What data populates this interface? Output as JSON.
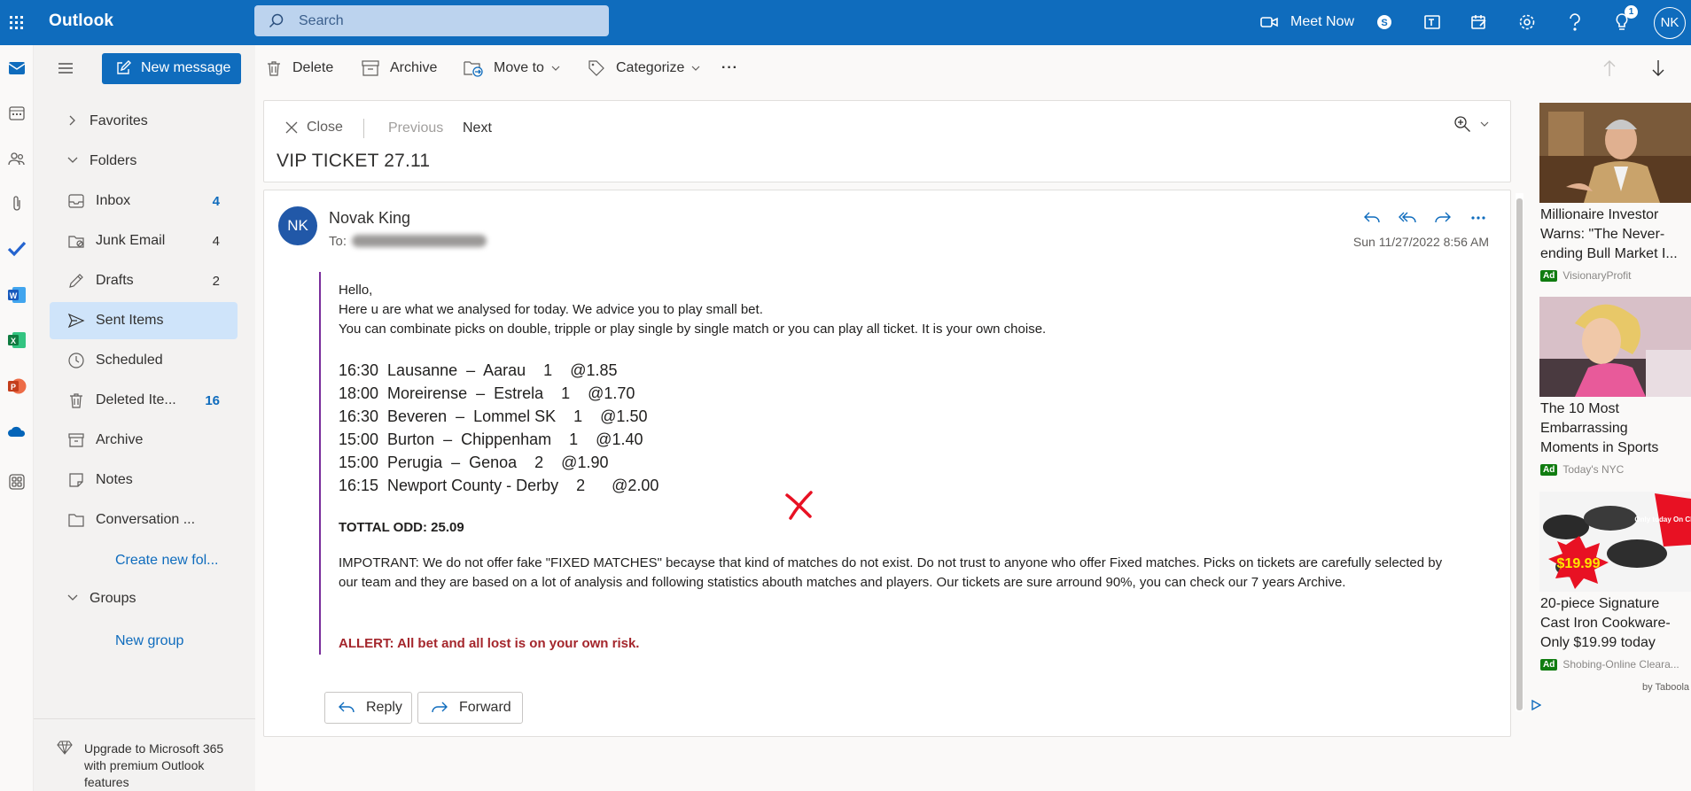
{
  "app": {
    "title": "Outlook",
    "avatar_initials": "NK",
    "notification_count": "1"
  },
  "search": {
    "placeholder": "Search"
  },
  "topbar": {
    "meet_now": "Meet Now"
  },
  "toolbar": {
    "new_message": "New message",
    "delete": "Delete",
    "archive": "Archive",
    "move_to": "Move to",
    "categorize": "Categorize",
    "more": "···"
  },
  "nav": {
    "favorites": "Favorites",
    "folders": "Folders",
    "items": [
      {
        "label": "Inbox",
        "count": "4"
      },
      {
        "label": "Junk Email",
        "count": "4"
      },
      {
        "label": "Drafts",
        "count": "2"
      },
      {
        "label": "Sent Items",
        "count": ""
      },
      {
        "label": "Scheduled",
        "count": ""
      },
      {
        "label": "Deleted Ite...",
        "count": "16"
      },
      {
        "label": "Archive",
        "count": ""
      },
      {
        "label": "Notes",
        "count": ""
      },
      {
        "label": "Conversation ...",
        "count": ""
      }
    ],
    "create_folder": "Create new fol...",
    "groups": "Groups",
    "new_group": "New group",
    "upgrade": "Upgrade to Microsoft 365 with premium Outlook features"
  },
  "reading": {
    "close": "Close",
    "previous": "Previous",
    "next": "Next",
    "subject": "VIP TICKET 27.11"
  },
  "message": {
    "avatar": "NK",
    "from": "Novak King",
    "to_label": "To:",
    "date": "Sun 11/27/2022 8:56 AM",
    "greeting": "Hello,",
    "line1": "Here u are what we analysed for today. We advice you to play small bet.",
    "line2": "You can combinate picks on double, tripple or play single by single match or you can play all ticket. It is your own choise.",
    "picks": [
      "16:30  Lausanne  –  Aarau    1    @1.85",
      "18:00  Moreirense  –  Estrela    1    @1.70",
      "16:30  Beveren  –  Lommel SK    1    @1.50",
      "15:00  Burton  –  Chippenham    1    @1.40",
      "15:00  Perugia  –  Genoa    2    @1.90",
      "16:15  Newport County - Derby    2      @2.00"
    ],
    "total": "TOTTAL ODD: 25.09",
    "important": "IMPOTRANT: We do not offer fake \"FIXED MATCHES\" becayse that kind of matches do not exist. Do not trust to anyone who offer Fixed matches. Picks on tickets are carefully selected by our team and they are based on a lot of analysis and following statistics abouth matches and players. Our tickets are sure arround 90%, you can check our 7 years Archive.",
    "alert": "ALLERT: All bet and all lost is on your own risk.",
    "reply": "Reply",
    "forward": "Forward"
  },
  "ads": [
    {
      "caption": "Millionaire Investor Warns: \"The Never-ending Bull Market I...",
      "tag": "Ad",
      "source": "VisionaryProfit"
    },
    {
      "caption": "The 10 Most Embarrassing Moments in Sports",
      "tag": "Ad",
      "source": "Today's NYC"
    },
    {
      "caption": "20-piece Signature Cast Iron Cookware-Only $19.99 today",
      "tag": "Ad",
      "source": "Shobing-Online Cleara...",
      "price": "$19.99",
      "sticker": "Only today On Clearance"
    }
  ],
  "taboola": "by Taboola"
}
